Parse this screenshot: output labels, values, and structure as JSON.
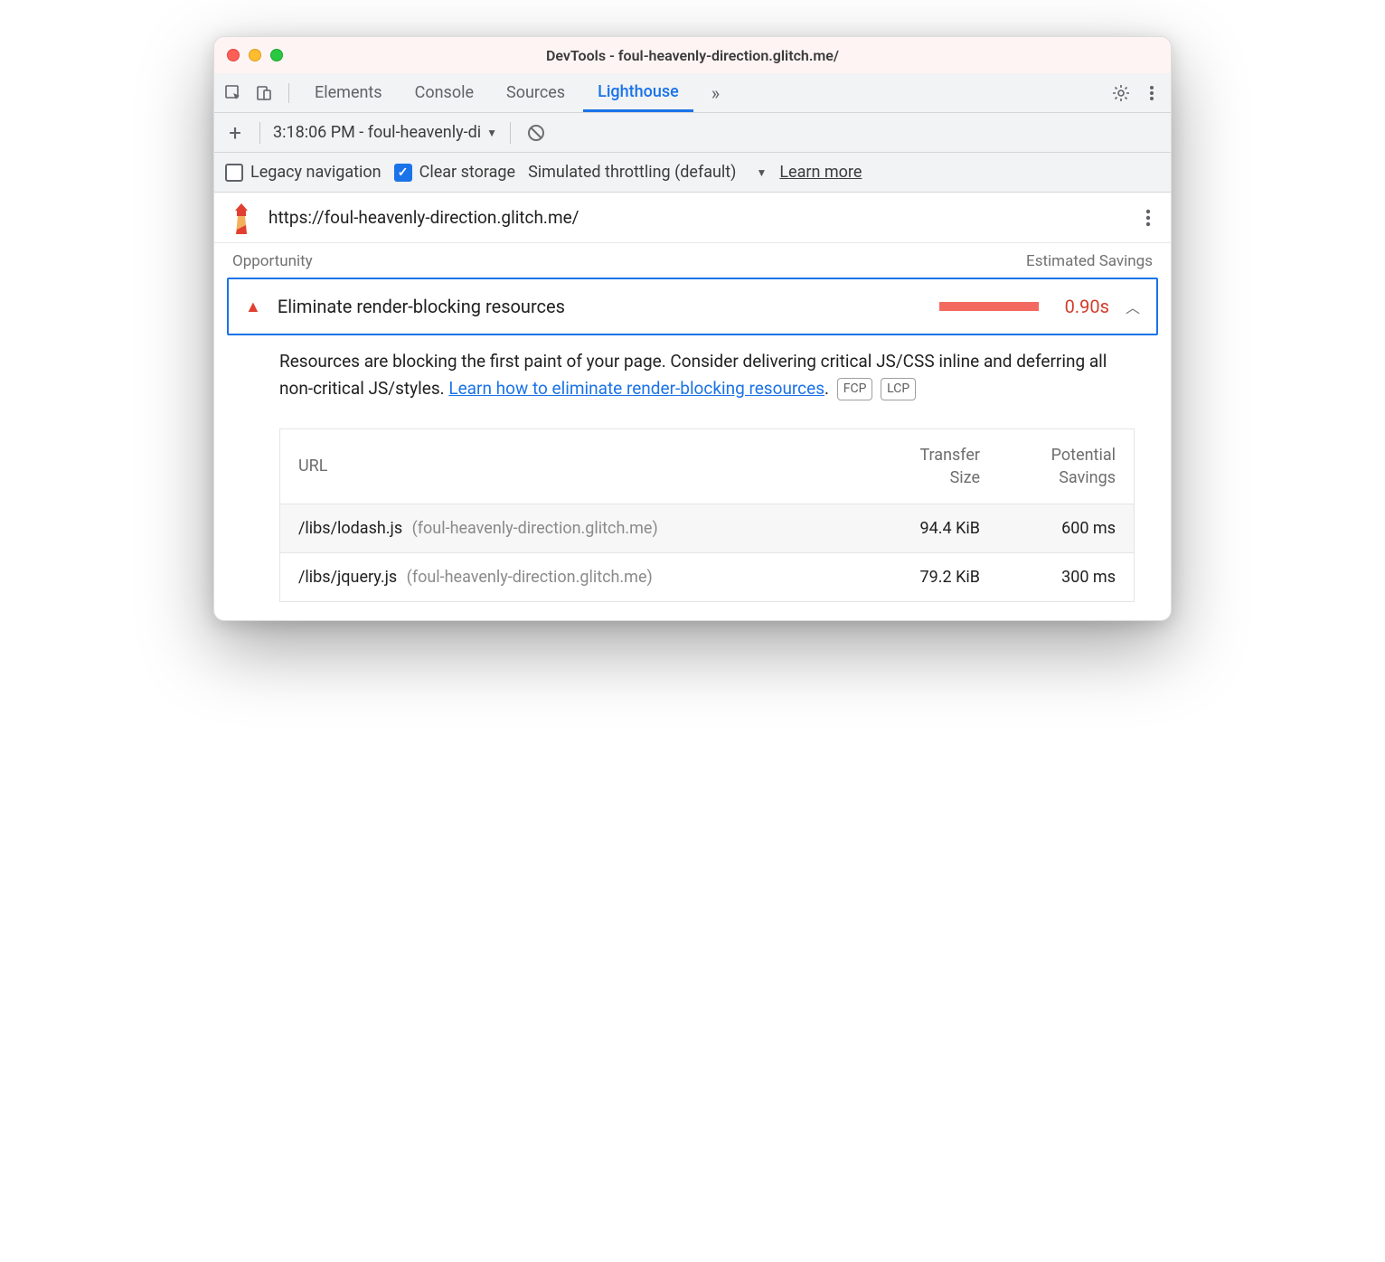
{
  "window": {
    "title": "DevTools - foul-heavenly-direction.glitch.me/"
  },
  "tabs": {
    "items": [
      "Elements",
      "Console",
      "Sources",
      "Lighthouse"
    ],
    "active": "Lighthouse",
    "overflow": "»"
  },
  "subbar": {
    "add_label": "+",
    "report_label": "3:18:06 PM - foul-heavenly-di"
  },
  "options": {
    "legacy_label": "Legacy navigation",
    "legacy_checked": false,
    "clear_label": "Clear storage",
    "clear_checked": true,
    "throttle_label": "Simulated throttling (default)",
    "learn_more": "Learn more"
  },
  "report": {
    "url": "https://foul-heavenly-direction.glitch.me/",
    "opportunity_header": "Opportunity",
    "savings_header": "Estimated Savings",
    "item": {
      "title": "Eliminate render-blocking resources",
      "time": "0.90s",
      "desc_prefix": "Resources are blocking the first paint of your page. Consider delivering critical JS/CSS inline and deferring all non-critical JS/styles. ",
      "desc_link": "Learn how to eliminate render-blocking resources",
      "desc_suffix": ".",
      "tags": [
        "FCP",
        "LCP"
      ]
    },
    "table": {
      "headers": {
        "url": "URL",
        "size": "Transfer Size",
        "savings": "Potential Savings"
      },
      "rows": [
        {
          "path": "/libs/lodash.js",
          "host": "(foul-heavenly-direction.glitch.me)",
          "size": "94.4 KiB",
          "savings": "600 ms"
        },
        {
          "path": "/libs/jquery.js",
          "host": "(foul-heavenly-direction.glitch.me)",
          "size": "79.2 KiB",
          "savings": "300 ms"
        }
      ]
    }
  }
}
